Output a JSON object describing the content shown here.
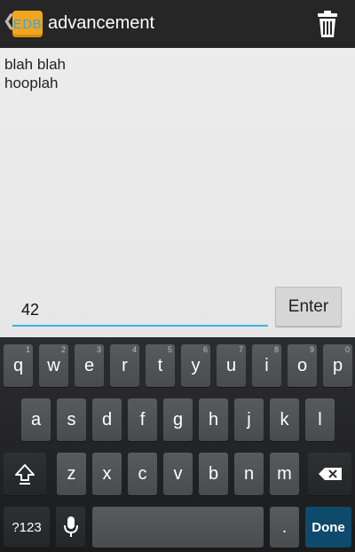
{
  "action_bar": {
    "up_caret": "❮",
    "app_icon_text": "EDB",
    "title": "advancement",
    "delete_icon": "trash-icon"
  },
  "content": {
    "output_text": "blah blah\nhooplah",
    "input_value": "42",
    "enter_label": "Enter"
  },
  "colors": {
    "accent": "#33b5e5",
    "app_icon": "#f2a51e",
    "done_key": "#0e4a6c"
  },
  "keyboard": {
    "row1": [
      {
        "label": "q",
        "hint": "1"
      },
      {
        "label": "w",
        "hint": "2"
      },
      {
        "label": "e",
        "hint": "3"
      },
      {
        "label": "r",
        "hint": "4"
      },
      {
        "label": "t",
        "hint": "5"
      },
      {
        "label": "y",
        "hint": "6"
      },
      {
        "label": "u",
        "hint": "7"
      },
      {
        "label": "i",
        "hint": "8"
      },
      {
        "label": "o",
        "hint": "9"
      },
      {
        "label": "p",
        "hint": "0"
      }
    ],
    "row2": [
      "a",
      "s",
      "d",
      "f",
      "g",
      "h",
      "j",
      "k",
      "l"
    ],
    "row3": [
      "z",
      "x",
      "c",
      "v",
      "b",
      "n",
      "m"
    ],
    "symbols_label": "?123",
    "period_label": ".",
    "done_label": "Done"
  }
}
